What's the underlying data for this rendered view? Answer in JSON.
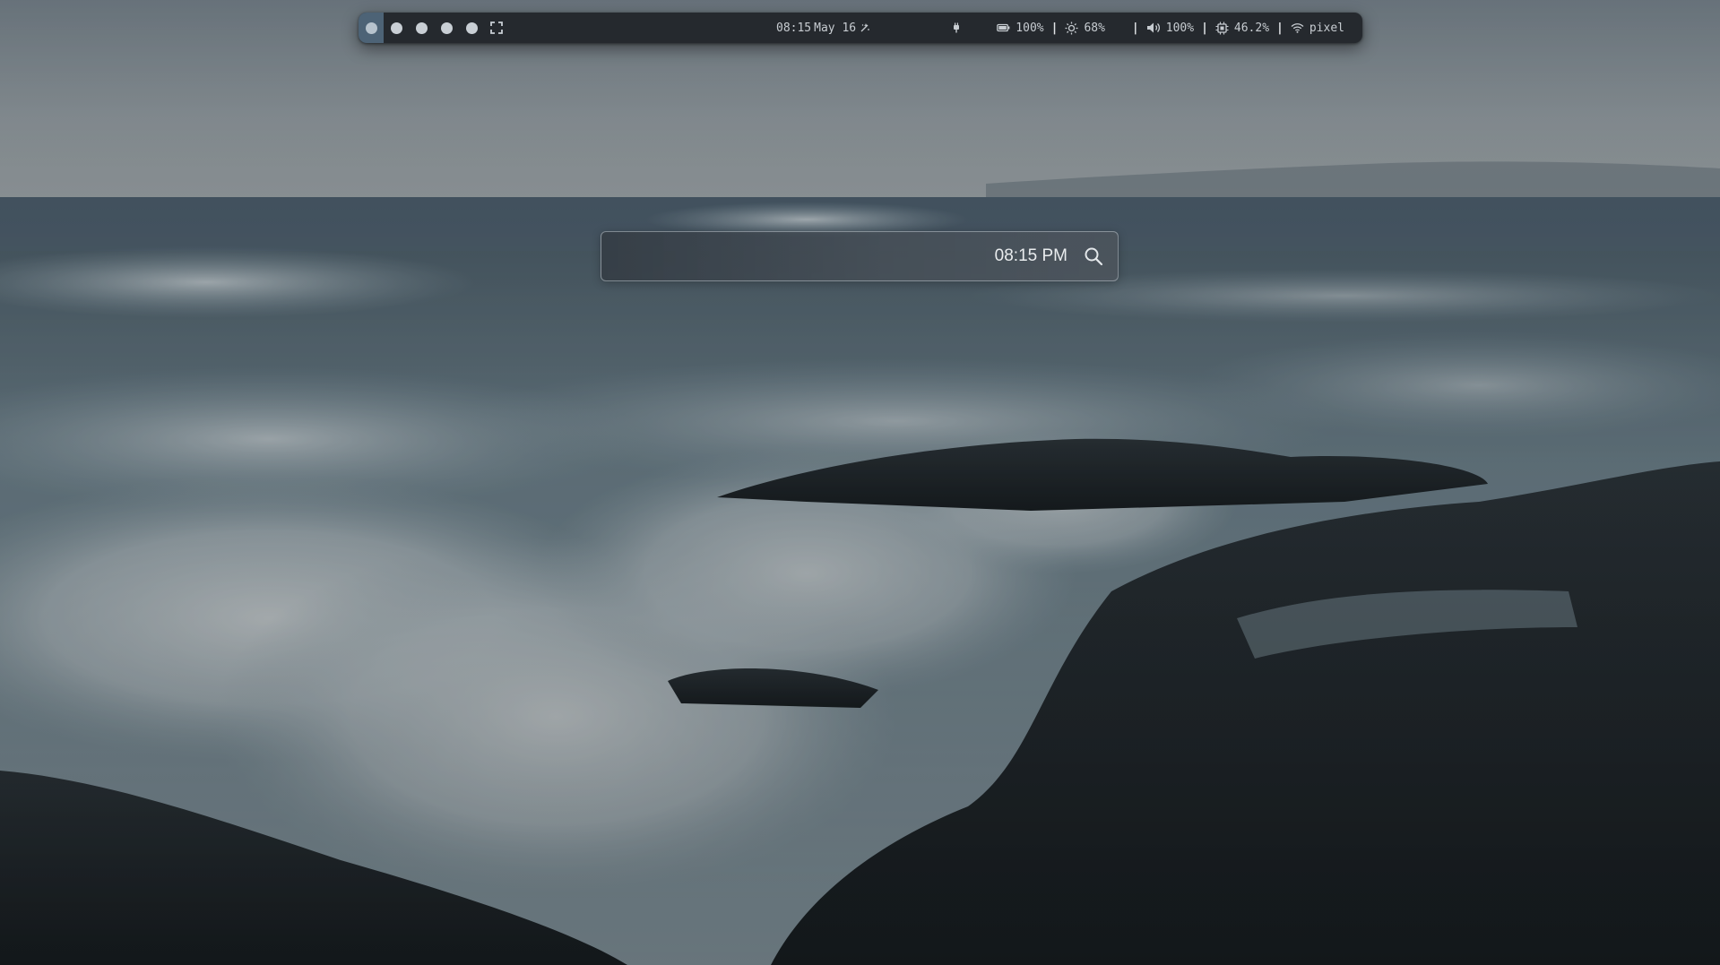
{
  "topbar": {
    "workspaces": [
      {
        "label": "workspace 1",
        "active": true
      },
      {
        "label": "workspace 2",
        "active": false
      },
      {
        "label": "workspace 3",
        "active": false
      },
      {
        "label": "workspace 4",
        "active": false
      },
      {
        "label": "workspace 5",
        "active": false
      }
    ],
    "fullscreen_icon": "fullscreen-icon",
    "clock": {
      "time": "08:15",
      "date": "May 16",
      "icon": "sparkle-icon"
    },
    "status": {
      "plug_icon": "plug-icon",
      "battery": {
        "icon": "battery-icon",
        "value": "100%"
      },
      "brightness": {
        "icon": "sun-icon",
        "value": "68%"
      },
      "volume": {
        "icon": "speaker-icon",
        "value": "100%"
      },
      "cpu": {
        "icon": "cpu-icon",
        "value": "46.2%"
      },
      "wifi": {
        "icon": "wifi-icon",
        "value": "pixel"
      },
      "separator": "|"
    }
  },
  "search": {
    "value": "",
    "placeholder": "",
    "time": "08:15 PM",
    "icon": "search-icon"
  },
  "colors": {
    "bar_bg": "#25292e",
    "active_workspace": "#4d6376",
    "bar_text": "#c7ccd1"
  }
}
